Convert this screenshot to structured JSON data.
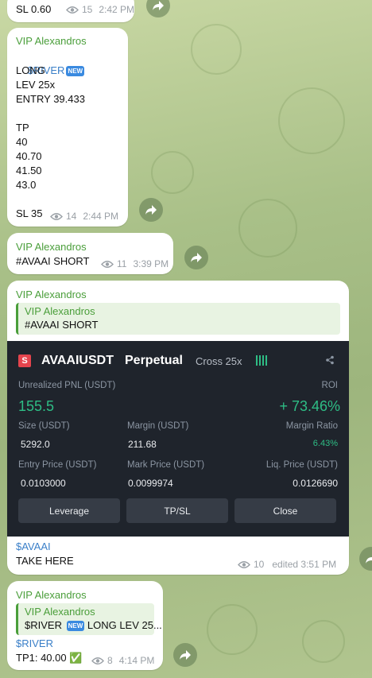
{
  "messages": [
    {
      "text_lines": [
        "SL 0.60"
      ],
      "views": "15",
      "time": "2:42 PM"
    },
    {
      "sender": "VIP Alexandros",
      "ticker": "$RIVER",
      "new_badge": "NEW",
      "text_lines": [
        "LONG",
        "LEV 25x",
        "ENTRY 39.433",
        "",
        "TP",
        "40",
        "40.70",
        "41.50",
        "43.0",
        "",
        "SL 35"
      ],
      "views": "14",
      "time": "2:44 PM"
    },
    {
      "sender": "VIP Alexandros",
      "text": "#AVAAI SHORT",
      "views": "11",
      "time": "3:39 PM"
    },
    {
      "sender": "VIP Alexandros",
      "quote": {
        "sender": "VIP Alexandros",
        "text": "#AVAAI SHORT"
      },
      "card": {
        "icon": "S",
        "symbol": "AVAAIUSDT",
        "contract": "Perpetual",
        "mode": "Cross 25x",
        "unrealized_pnl_label": "Unrealized PNL (USDT)",
        "unrealized_pnl": "155.5",
        "roi_label": "ROI",
        "roi": "+ 73.46%",
        "size_label": "Size (USDT)",
        "size": "5292.0",
        "margin_label": "Margin (USDT)",
        "margin": "211.68",
        "margin_ratio_label": "Margin Ratio",
        "margin_ratio": "6.43%",
        "entry_price_label": "Entry Price (USDT)",
        "entry_price": "0.0103000",
        "mark_price_label": "Mark Price (USDT)",
        "mark_price": "0.0099974",
        "liq_price_label": "Liq. Price (USDT)",
        "liq_price": "0.0126690",
        "buttons": [
          "Leverage",
          "TP/SL",
          "Close"
        ]
      },
      "text_lines": [
        "$AVAAI",
        "TAKE HERE"
      ],
      "views": "10",
      "time": "edited 3:51 PM"
    },
    {
      "sender": "VIP Alexandros",
      "quote": {
        "sender": "VIP Alexandros",
        "text": "$RIVER ",
        "badge": "NEW",
        "text_after": " LONG LEV 25..."
      },
      "text_lines": [
        "$RIVER",
        "TP1: 40.00 ✅"
      ],
      "views": "8",
      "time": "4:14 PM"
    }
  ],
  "colors": {
    "sender": "#4a9e3a",
    "profit": "#2ebd85",
    "card_bg": "#1f242c"
  }
}
